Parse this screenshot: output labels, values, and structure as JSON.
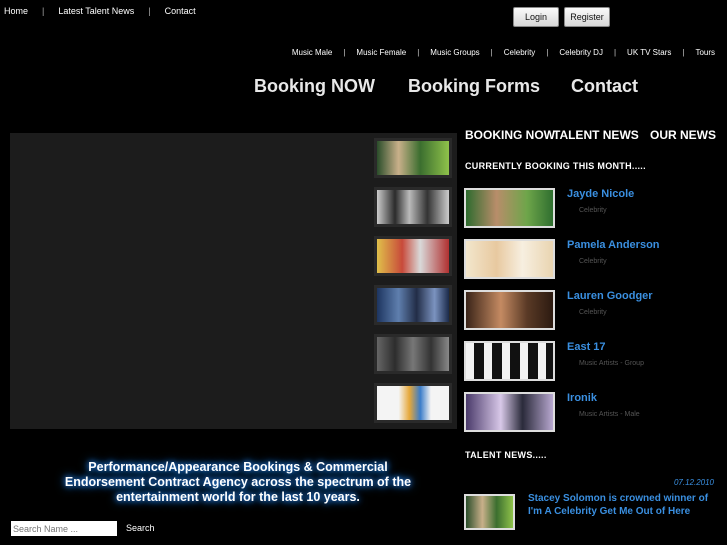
{
  "topnav": [
    "Home",
    "Latest Talent News",
    "Contact"
  ],
  "auth": {
    "login": "Login",
    "register": "Register"
  },
  "categories": [
    "Music Male",
    "Music Female",
    "Music Groups",
    "Celebrity",
    "Celebrity DJ",
    "UK TV Stars",
    "Tours"
  ],
  "mainnav": {
    "booking_now": "Booking NOW",
    "booking_forms": "Booking Forms",
    "contact": "Contact"
  },
  "right_tabs": {
    "booking_now": "BOOKING NOW",
    "talent_news": "TALENT NEWS",
    "our_news": "OUR NEWS"
  },
  "booking_heading": "CURRENTLY BOOKING THIS MONTH.....",
  "booking_list": [
    {
      "name": "Jayde Nicole",
      "category": "Celebrity"
    },
    {
      "name": "Pamela Anderson",
      "category": "Celebrity"
    },
    {
      "name": "Lauren Goodger",
      "category": "Celebrity"
    },
    {
      "name": "East 17",
      "category": "Music Artists - Group"
    },
    {
      "name": "Ironik",
      "category": "Music Artists - Male"
    }
  ],
  "talent_news_heading": "TALENT NEWS.....",
  "news": {
    "date": "07.12.2010",
    "title": "Stacey Solomon is crowned winner of I'm A Celebrity Get Me Out of Here"
  },
  "tagline": "Performance/Appearance Bookings & Commercial Endorsement Contract Agency across the spectrum of the entertainment world for the last 10 years.",
  "search": {
    "placeholder": "Search Name ...",
    "button": "Search"
  },
  "colors": {
    "accent": "#3a8fe0",
    "background": "#000000",
    "panel": "#1c1c1c"
  }
}
